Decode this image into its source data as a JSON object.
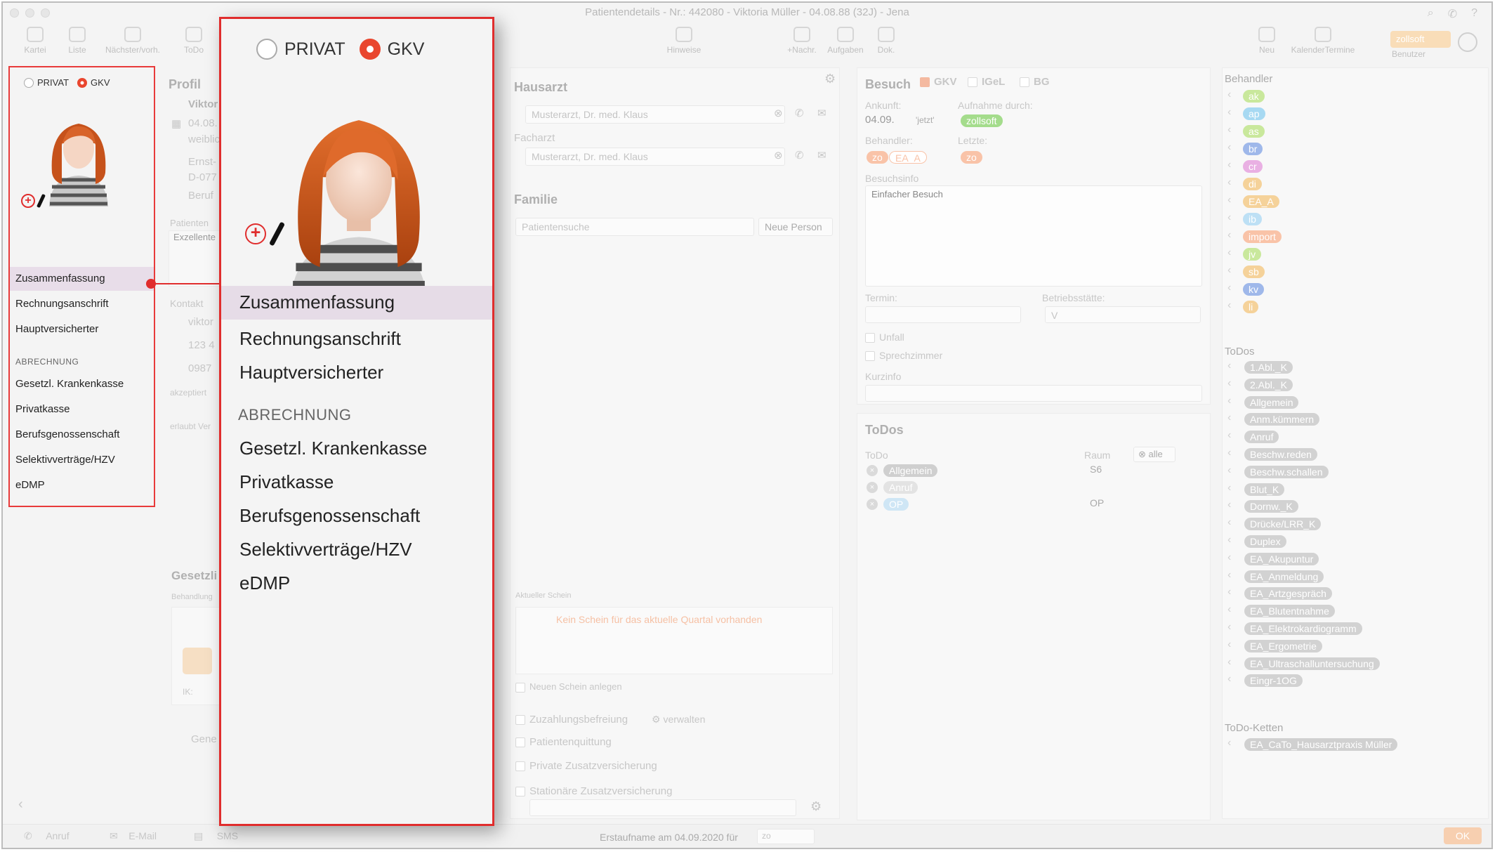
{
  "window": {
    "title": "Patientendetails - Nr.: 442080 - Viktoria Müller - 04.08.88 (32J) - Jena"
  },
  "toolbar": {
    "left": [
      "Kartei",
      "Liste",
      "Nächster/vorh.",
      "ToDo"
    ],
    "center": [
      "Hinweise",
      "+Nachr.",
      "Aufgaben",
      "Dok."
    ],
    "right": [
      "Neu",
      "KalenderTermine",
      "Benutzer"
    ],
    "zollsoft": "zollsoft"
  },
  "sidebar": {
    "privat_label": "PRIVAT",
    "gkv_label": "GKV",
    "items_top": [
      "Zusammenfassung",
      "Rechnungsanschrift",
      "Hauptversicherter"
    ],
    "section_label": "ABRECHNUNG",
    "items_billing": [
      "Gesetzl. Krankenkasse",
      "Privatkasse",
      "Berufsgenossenschaft",
      "Selektivverträge/HZV",
      "eDMP"
    ]
  },
  "profil": {
    "title": "Profil",
    "name": "Viktor",
    "dob": "04.08.",
    "gender": "weiblic",
    "street": "Ernst-",
    "city": "D-077",
    "beruf": "Beruf",
    "patienteninfo_label": "Patienten",
    "patienteninfo_value": "Exzellente",
    "kontakt_label": "Kontakt",
    "email": "viktor",
    "phone": "123 4",
    "mobile": "0987",
    "akzeptiert": "akzeptiert",
    "erlaubt": "erlaubt Ver",
    "gesetzl": "Gesetzli",
    "behandlung": "Behandlung",
    "ik": "IK:",
    "gene": "Gene"
  },
  "hausarzt": {
    "title": "Hausarzt",
    "hausarzt_value": "Musterarzt, Dr. med.  Klaus",
    "facharzt_label": "Facharzt",
    "facharzt_value": "Musterarzt, Dr. med.  Klaus",
    "familie_title": "Familie",
    "patientensuche": "Patientensuche",
    "neue_person": "Neue Person"
  },
  "schein": {
    "aktueller": "Aktueller Schein",
    "kein": "Kein Schein für das aktuelle Quartal vorhanden",
    "neuen": "Neuen Schein anlegen",
    "zuzahlung": "Zuzahlungsbefreiung",
    "verwalten": "verwalten",
    "quittung": "Patientenquittung",
    "private": "Private Zusatzversicherung",
    "stationaere": "Stationäre Zusatzversicherung"
  },
  "besuch": {
    "title": "Besuch",
    "gkv": "GKV",
    "igel": "IGeL",
    "bg": "BG",
    "ankunft_label": "Ankunft:",
    "ankunft_value": "04.09.",
    "jetzt": "'jetzt'",
    "aufnahme_label": "Aufnahme durch:",
    "aufnahme_value": "zollsoft",
    "behandler_label": "Behandler:",
    "behandler_tags": [
      "zo",
      "EA_A"
    ],
    "letzte_label": "Letzte:",
    "letzte_tag": "zo",
    "besuchsinfo_label": "Besuchsinfo",
    "besuchsinfo_value": "Einfacher Besuch",
    "termin_label": "Termin:",
    "betriebsstaette_label": "Betriebsstätte:",
    "betriebsstaette_value": "V",
    "unfall": "Unfall",
    "sprechzimmer": "Sprechzimmer",
    "kurzinfo_label": "Kurzinfo"
  },
  "todos_mid": {
    "title": "ToDos",
    "col_todo": "ToDo",
    "col_raum": "Raum",
    "alle": "alle",
    "rows": [
      {
        "tag": "Allgemein",
        "raum": "S6"
      },
      {
        "tag": "Anruf",
        "raum": ""
      },
      {
        "tag": "OP",
        "raum": "OP"
      }
    ]
  },
  "right": {
    "behandler_title": "Behandler",
    "behandler": [
      "ak",
      "ap",
      "as",
      "br",
      "cr",
      "di",
      "EA_A",
      "ib",
      "import",
      "jv",
      "sb",
      "kv",
      "li"
    ],
    "behandler_colors": [
      "#c9e89c",
      "#a7d9f2",
      "#c9e89c",
      "#9fb8ea",
      "#e9b0e3",
      "#f5d29a",
      "#f5d29a",
      "#bde0f5",
      "#f9c3a8",
      "#c9e89c",
      "#f5d29a",
      "#9fb8ea",
      "#f5d29a"
    ],
    "todos_title": "ToDos",
    "todos": [
      "1.Abl._K",
      "2.Abl._K",
      "Allgemein",
      "Anm.kümmern",
      "Anruf",
      "Beschw.reden",
      "Beschw.schallen",
      "Blut_K",
      "Dornw._K",
      "Drücke/LRR_K",
      "Duplex",
      "EA_Akupuntur",
      "EA_Anmeldung",
      "EA_Artzgespräch",
      "EA_Blutentnahme",
      "EA_Elektrokardiogramm",
      "EA_Ergometrie",
      "EA_Ultraschalluntersuchung",
      "Eingr-1OG"
    ],
    "ketten_title": "ToDo-Ketten",
    "ketten": [
      "EA_CaTo_Hausarztpraxis Müller"
    ]
  },
  "statusbar": {
    "anruf": "Anruf",
    "email": "E-Mail",
    "sms": "SMS",
    "erstaufnahme": "Erstaufname am 04.09.2020 für",
    "erstaufnahme_value": "zo",
    "ok": "OK"
  }
}
